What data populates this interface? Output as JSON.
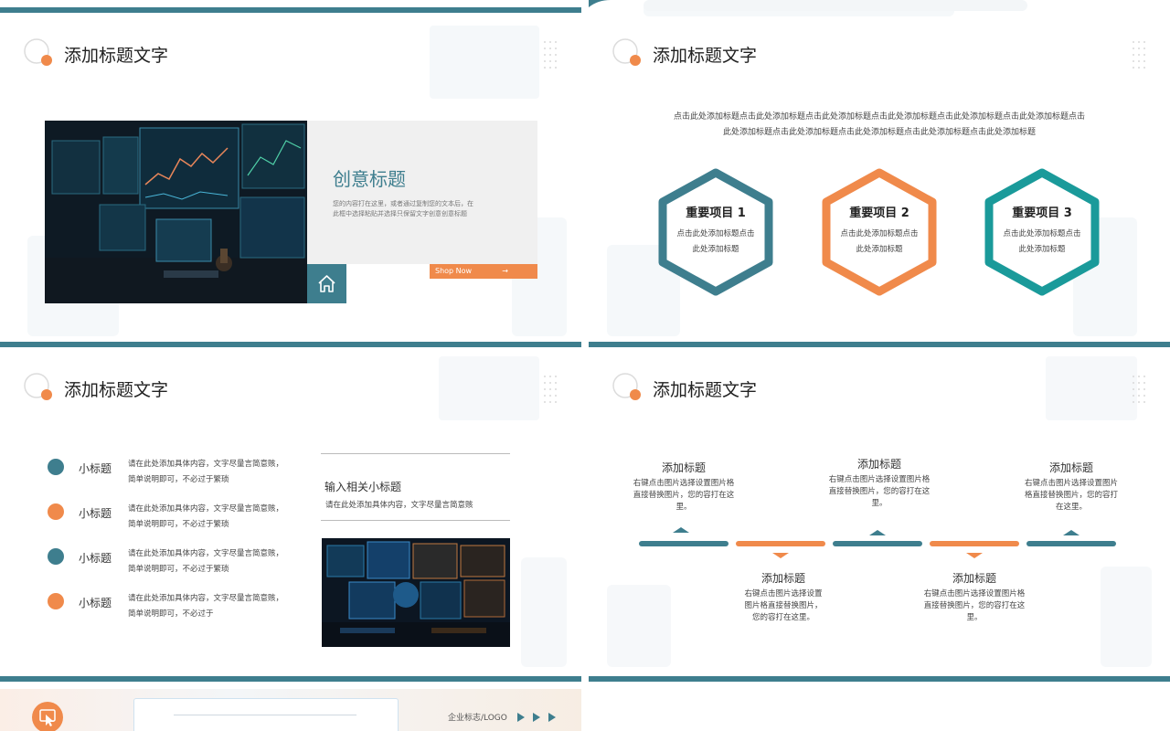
{
  "colors": {
    "teal": "#3e7e8e",
    "orange": "#f08a4b",
    "cyan": "#1a9a9a",
    "panel": "#f0f0f0"
  },
  "slide1": {
    "title": "添加标题文字",
    "heading": "创意标题",
    "body": "您的内容打在这里，或者通过复制您的文本后，在此框中选择粘贴并选择只保留文字创意创意标题",
    "shop_label": "Shop Now",
    "shop_arrow": "→",
    "home_icon": "home-icon"
  },
  "slide2": {
    "title": "添加标题文字",
    "intro": "点击此处添加标题点击此处添加标题点击此处添加标题点击此处添加标题点击此处添加标题点击此处添加标题点击此处添加标题点击此处添加标题点击此处添加标题点击此处添加标题点击此处添加标题",
    "hexagons": [
      {
        "title": "重要项目 1",
        "body": "点击此处添加标题点击此处添加标题"
      },
      {
        "title": "重要项目 2",
        "body": "点击此处添加标题点击此处添加标题"
      },
      {
        "title": "重要项目 3",
        "body": "点击此处添加标题点击此处添加标题"
      }
    ]
  },
  "slide3": {
    "title": "添加标题文字",
    "items": [
      {
        "label": "小标题",
        "text": "请在此处添加具体内容，文字尽量言简意赅，简单说明即可，不必过于繁琐"
      },
      {
        "label": "小标题",
        "text": "请在此处添加具体内容，文字尽量言简意赅，简单说明即可，不必过于繁琐"
      },
      {
        "label": "小标题",
        "text": "请在此处添加具体内容，文字尽量言简意赅，简单说明即可，不必过于繁琐"
      },
      {
        "label": "小标题",
        "text": "请在此处添加具体内容，文字尽量言简意赅，简单说明即可，不必过于"
      }
    ],
    "subheading": "输入相关小标题",
    "subtext": "请在此处添加具体内容，文字尽量言简意赅"
  },
  "slide4": {
    "title": "添加标题文字",
    "milestones": [
      {
        "title": "添加标题",
        "text": "右键点击图片选择设置图片格直接替换图片，您的容打在这里。"
      },
      {
        "title": "添加标题",
        "text": "右键点击图片选择设置图片格直接替换图片，您的容打在这里。"
      },
      {
        "title": "添加标题",
        "text": "右键点击图片选择设置图片格直接替换图片，您的容打在这里。"
      },
      {
        "title": "添加标题",
        "text": "右键点击图片选择设置图片格直接替换图片，您的容打在这里。"
      },
      {
        "title": "添加标题",
        "text": "右键点击图片选择设置图片格直接替换图片，您的容打在这里。"
      }
    ]
  },
  "slide5": {
    "logo_text": "企业标志/LOGO",
    "icon": "click-cursor-icon"
  }
}
